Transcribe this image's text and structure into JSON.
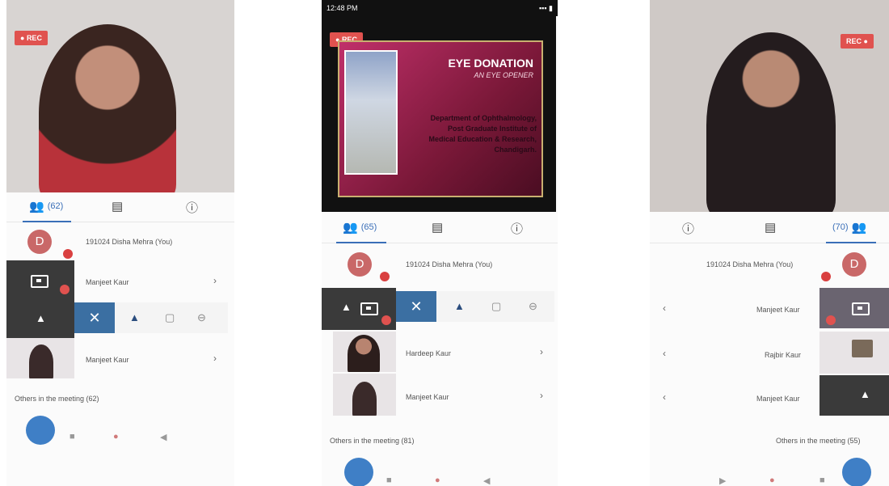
{
  "phone1": {
    "rec_label": "REC",
    "tab_participants": "(62)",
    "self_avatar": "D",
    "self_name": "191024 Disha Mehra (You)",
    "row1_name": "Manjeet Kaur",
    "row2_name": "Manjeet Kaur",
    "others_label": "Others in the meeting (62)"
  },
  "phone2": {
    "status_time": "12:48 PM",
    "rec_label": "REC",
    "slide_title": "EYE DONATION",
    "slide_subtitle": "AN EYE OPENER",
    "slide_line1": "Department of Ophthalmology,",
    "slide_line2": "Post Graduate Institute of",
    "slide_line3": "Medical Education & Research,",
    "slide_line4": "Chandigarh.",
    "tab_participants": "(65)",
    "self_avatar": "D",
    "self_name": "191024 Disha Mehra (You)",
    "row1_name": "Hardeep Kaur",
    "row2_name": "Manjeet Kaur",
    "others_label": "Others in the meeting (81)"
  },
  "phone3": {
    "rec_label": "REC",
    "tab_participants": "(70)",
    "self_avatar": "D",
    "self_name": "191024 Disha Mehra (You)",
    "row1_name": "Manjeet Kaur",
    "row2_name": "Rajbir Kaur",
    "row3_name": "Manjeet Kaur",
    "others_label": "Others in the meeting (55)"
  },
  "colors": {
    "accent": "#3a6fb8",
    "rec": "#e0524f",
    "avatar": "#c96868",
    "control_active": "#3b6fa2"
  },
  "icons": [
    "participants-icon",
    "chat-icon",
    "info-icon",
    "chevron-right-icon",
    "close-icon",
    "pin-icon",
    "camera-icon",
    "mic-muted-icon"
  ]
}
